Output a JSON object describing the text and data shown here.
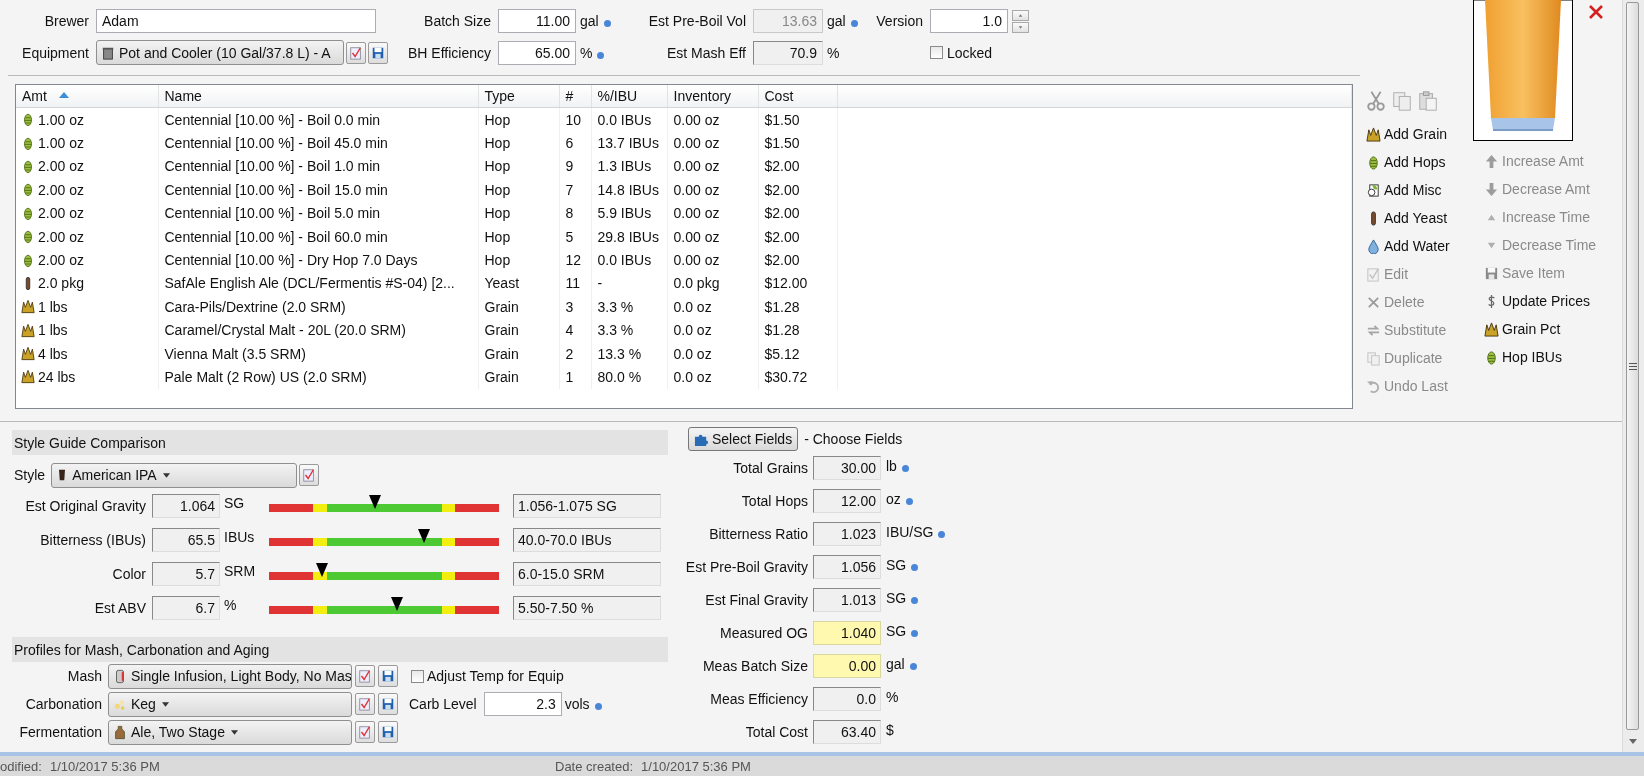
{
  "header": {
    "brewer": {
      "label": "Brewer",
      "value": "Adam"
    },
    "equipment": {
      "label": "Equipment",
      "value": "Pot and Cooler (10 Gal/37.8 L) - A"
    },
    "batch_size": {
      "label": "Batch Size",
      "value": "11.00",
      "unit": "gal",
      "linked": true,
      "kind": "input"
    },
    "bh_efficiency": {
      "label": "BH Efficiency",
      "value": "65.00",
      "unit": "%",
      "linked": true,
      "kind": "input"
    },
    "pre_boil_vol": {
      "label": "Est Pre-Boil Vol",
      "value": "13.63",
      "unit": "gal",
      "linked": true,
      "kind": "disabled"
    },
    "mash_eff": {
      "label": "Est Mash Eff",
      "value": "70.9",
      "unit": "%",
      "linked": false,
      "kind": "readonly"
    },
    "version": {
      "label": "Version",
      "value": "1.0"
    },
    "locked": {
      "label": "Locked",
      "checked": false
    }
  },
  "ingredients": {
    "columns": [
      {
        "label": "Amt",
        "sorted": true
      },
      {
        "label": "Name",
        "sorted": false
      },
      {
        "label": "Type",
        "sorted": false
      },
      {
        "label": "#",
        "sorted": false
      },
      {
        "label": "%/IBU",
        "sorted": false
      },
      {
        "label": "Inventory",
        "sorted": false
      },
      {
        "label": "Cost",
        "sorted": false
      }
    ],
    "rows": [
      {
        "kind": "hop",
        "cells": [
          "1.00 oz",
          "Centennial [10.00 %] - Boil 0.0 min",
          "Hop",
          "10",
          "0.0 IBUs",
          "0.00 oz",
          "$1.50"
        ]
      },
      {
        "kind": "hop",
        "cells": [
          "1.00 oz",
          "Centennial [10.00 %] - Boil 45.0 min",
          "Hop",
          "6",
          "13.7 IBUs",
          "0.00 oz",
          "$1.50"
        ]
      },
      {
        "kind": "hop",
        "cells": [
          "2.00 oz",
          "Centennial [10.00 %] - Boil 1.0 min",
          "Hop",
          "9",
          "1.3 IBUs",
          "0.00 oz",
          "$2.00"
        ]
      },
      {
        "kind": "hop",
        "cells": [
          "2.00 oz",
          "Centennial [10.00 %] - Boil 15.0 min",
          "Hop",
          "7",
          "14.8 IBUs",
          "0.00 oz",
          "$2.00"
        ]
      },
      {
        "kind": "hop",
        "cells": [
          "2.00 oz",
          "Centennial [10.00 %] - Boil 5.0 min",
          "Hop",
          "8",
          "5.9 IBUs",
          "0.00 oz",
          "$2.00"
        ]
      },
      {
        "kind": "hop",
        "cells": [
          "2.00 oz",
          "Centennial [10.00 %] - Boil 60.0 min",
          "Hop",
          "5",
          "29.8 IBUs",
          "0.00 oz",
          "$2.00"
        ]
      },
      {
        "kind": "hop",
        "cells": [
          "2.00 oz",
          "Centennial [10.00 %] - Dry Hop 7.0 Days",
          "Hop",
          "12",
          "0.0 IBUs",
          "0.00 oz",
          "$2.00"
        ]
      },
      {
        "kind": "yeast",
        "cells": [
          "2.0 pkg",
          "SafAle English Ale (DCL/Fermentis #S-04) [2...",
          "Yeast",
          "11",
          "-",
          "0.0 pkg",
          "$12.00"
        ]
      },
      {
        "kind": "grain",
        "cells": [
          "1 lbs",
          "Cara-Pils/Dextrine (2.0 SRM)",
          "Grain",
          "3",
          "3.3 %",
          "0.0 oz",
          "$1.28"
        ]
      },
      {
        "kind": "grain",
        "cells": [
          "1 lbs",
          "Caramel/Crystal Malt - 20L (20.0 SRM)",
          "Grain",
          "4",
          "3.3 %",
          "0.0 oz",
          "$1.28"
        ]
      },
      {
        "kind": "grain",
        "cells": [
          "4 lbs",
          "Vienna Malt (3.5 SRM)",
          "Grain",
          "2",
          "13.3 %",
          "0.0 oz",
          "$5.12"
        ]
      },
      {
        "kind": "grain",
        "cells": [
          "24 lbs",
          "Pale Malt (2 Row) US (2.0 SRM)",
          "Grain",
          "1",
          "80.0 %",
          "0.0 oz",
          "$30.72"
        ]
      }
    ]
  },
  "actions": [
    [
      {
        "label": "Add Grain",
        "kind": "grain",
        "disabled": false
      },
      {
        "label": "Add Hops",
        "kind": "hop",
        "disabled": false
      },
      {
        "label": "Add Misc",
        "kind": "misc",
        "disabled": false
      },
      {
        "label": "Add Yeast",
        "kind": "yeast",
        "disabled": false
      },
      {
        "label": "Add Water",
        "kind": "water",
        "disabled": false
      },
      {
        "label": "Edit",
        "kind": "edit",
        "disabled": true
      },
      {
        "label": "Delete",
        "kind": "delete",
        "disabled": true
      },
      {
        "label": "Substitute",
        "kind": "substitute",
        "disabled": true
      },
      {
        "label": "Duplicate",
        "kind": "duplicate",
        "disabled": true
      },
      {
        "label": "Undo Last",
        "kind": "undo",
        "disabled": true
      }
    ],
    [
      {
        "label": "Increase Amt",
        "kind": "arrow-up",
        "disabled": true
      },
      {
        "label": "Decrease Amt",
        "kind": "arrow-down",
        "disabled": true
      },
      {
        "label": "Increase Time",
        "kind": "tri-up",
        "disabled": true
      },
      {
        "label": "Decrease Time",
        "kind": "tri-down",
        "disabled": true
      },
      {
        "label": "Save Item",
        "kind": "save",
        "disabled": true
      },
      {
        "label": "Update Prices",
        "kind": "dollar",
        "disabled": false
      },
      {
        "label": "Grain Pct",
        "kind": "grain",
        "disabled": false
      },
      {
        "label": "Hop IBUs",
        "kind": "hop",
        "disabled": false
      }
    ]
  ],
  "style_guide": {
    "title": "Style Guide Comparison",
    "style_label": "Style",
    "style": "American IPA",
    "metrics": [
      {
        "label": "Est Original Gravity",
        "value": "1.064",
        "unit": "SG",
        "level": 0.46,
        "range": "1.056-1.075 SG"
      },
      {
        "label": "Bitterness (IBUs)",
        "value": "65.5",
        "unit": "IBUs",
        "level": 0.675,
        "range": "40.0-70.0 IBUs"
      },
      {
        "label": "Color",
        "value": "5.7",
        "unit": "SRM",
        "level": 0.23,
        "range": "6.0-15.0 SRM"
      },
      {
        "label": "Est ABV",
        "value": "6.7",
        "unit": "%",
        "level": 0.557,
        "range": "5.50-7.50 %"
      }
    ]
  },
  "profiles": {
    "title": "Profiles for Mash, Carbonation and Aging",
    "rows": [
      {
        "kind": "mash",
        "label": "Mash",
        "value": "Single Infusion, Light Body, No Mas"
      },
      {
        "kind": "carbonation",
        "label": "Carbonation",
        "value": "Keg"
      },
      {
        "kind": "fermentation",
        "label": "Fermentation",
        "value": "Ale, Two Stage"
      }
    ],
    "adjust_temp": {
      "label": "Adjust Temp for Equip",
      "checked": false
    },
    "carb_level": {
      "label": "Carb Level",
      "value": "2.3",
      "unit": "vols",
      "linked": true
    }
  },
  "stats": {
    "button": "Select Fields",
    "caption": "- Choose Fields",
    "rows": [
      {
        "label": "Total Grains",
        "value": "30.00",
        "unit": "lb",
        "linked": true,
        "highlighted": false
      },
      {
        "label": "Total Hops",
        "value": "12.00",
        "unit": "oz",
        "linked": true,
        "highlighted": false
      },
      {
        "label": "Bitterness Ratio",
        "value": "1.023",
        "unit": "IBU/SG",
        "linked": true,
        "highlighted": false
      },
      {
        "label": "Est Pre-Boil Gravity",
        "value": "1.056",
        "unit": "SG",
        "linked": true,
        "highlighted": false
      },
      {
        "label": "Est Final Gravity",
        "value": "1.013",
        "unit": "SG",
        "linked": true,
        "highlighted": false
      },
      {
        "label": "Measured OG",
        "value": "1.040",
        "unit": "SG",
        "linked": true,
        "highlighted": true
      },
      {
        "label": "Meas Batch Size",
        "value": "0.00",
        "unit": "gal",
        "linked": true,
        "highlighted": true
      },
      {
        "label": "Meas Efficiency",
        "value": "0.0",
        "unit": "%",
        "linked": false,
        "highlighted": false
      },
      {
        "label": "Total Cost",
        "value": "63.40",
        "unit": "$",
        "linked": false,
        "highlighted": false
      }
    ]
  },
  "status_bar": [
    {
      "label": "odified:",
      "value": "1/10/2017 5:36 PM"
    },
    {
      "label": "Date created:",
      "value": "1/10/2017 5:36 PM"
    }
  ]
}
